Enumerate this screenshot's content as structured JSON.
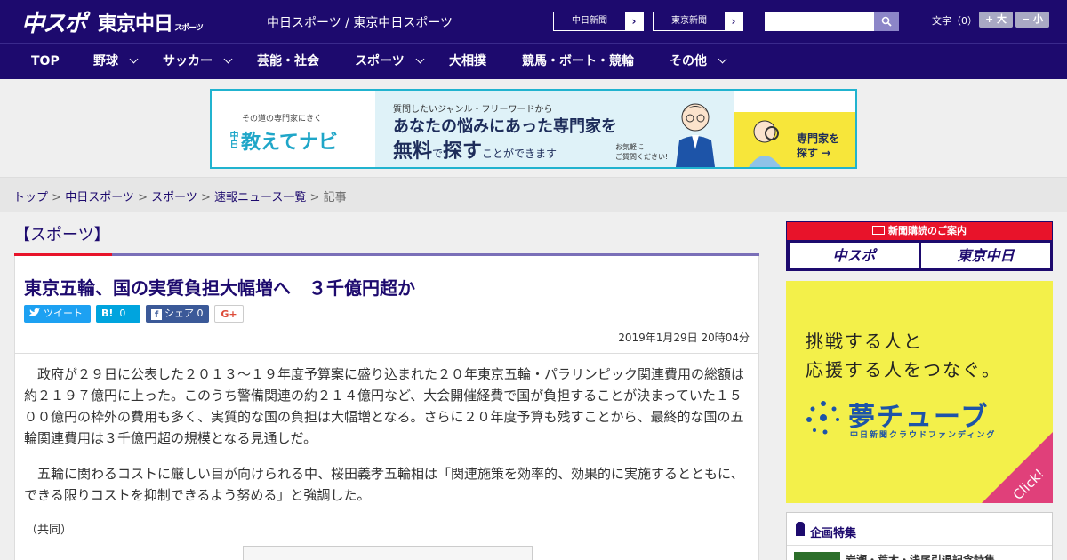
{
  "header": {
    "logo_chuspo": "中スポ",
    "logo_tokyo": "東京中日",
    "logo_tokyo_small": "スポーツ",
    "site_title": "中日スポーツ / 東京中日スポーツ",
    "paper_buttons": [
      "中日新聞",
      "東京新聞"
    ],
    "search_placeholder": "",
    "font_size_label": "文字（0）",
    "font_plus": "+ 大",
    "font_minus": "− 小"
  },
  "nav": {
    "items": [
      {
        "label": "TOP",
        "dropdown": false
      },
      {
        "label": "野球",
        "dropdown": true
      },
      {
        "label": "サッカー",
        "dropdown": true
      },
      {
        "label": "芸能・社会",
        "dropdown": false
      },
      {
        "label": "スポーツ",
        "dropdown": true
      },
      {
        "label": "大相撲",
        "dropdown": false
      },
      {
        "label": "競馬・ボート・競輪",
        "dropdown": false
      },
      {
        "label": "その他",
        "dropdown": true
      }
    ]
  },
  "banner": {
    "left_small": "その道の専門家にきく",
    "left_brand": "教えてナビ",
    "left_brand_prefix": "中日",
    "line1": "質問したいジャンル・フリーワードから",
    "line2": "あなたの悩みにあった専門家を",
    "line3a": "無料",
    "line3b": "で",
    "line3c": "探す",
    "line3d": "ことができます",
    "note": "お気軽に\nご質問ください!",
    "cta": "専門家を\n探す →"
  },
  "breadcrumb": {
    "items": [
      "トップ",
      "中日スポーツ",
      "スポーツ",
      "速報ニュース一覧"
    ],
    "current": "記事",
    "sep": " > "
  },
  "article": {
    "category": "【スポーツ】",
    "title": "東京五輪、国の実質負担大幅増へ　３千億円超か",
    "share": {
      "tweet": "ツイート",
      "hatena": "B!",
      "hatena_count": "0",
      "facebook": "シェア",
      "facebook_count": "0",
      "gplus": "G+"
    },
    "date": "2019年1月29日 20時04分",
    "paragraphs": [
      "政府が２９日に公表した２０１３～１９年度予算案に盛り込まれた２０年東京五輪・パラリンピック関連費用の総額は約２１９７億円に上った。このうち警備関連の約２１４億円など、大会開催経費で国が負担することが決まっていた１５００億円の枠外の費用も多く、実質的な国の負担は大幅増となる。さらに２０年度予算も残すことから、最終的な国の五輪関連費用は３千億円超の規模となる見通しだ。",
      "五輪に関わるコストに厳しい目が向けられる中、桜田義孝五輪相は「関連施策を効率的、効果的に実施するとともに、できる限りコストを抑制できるよう努める」と強調した。"
    ],
    "credit": "（共同）"
  },
  "sidebar": {
    "subscribe_title": "新聞購読のご案内",
    "subscribe_btn1": "中スポ",
    "subscribe_btn2": "東京中日",
    "ad_heading_1": "挑戦する人と",
    "ad_heading_2": "応援する人をつなぐ。",
    "ad_logo": "夢チューブ",
    "ad_sub": "中日新聞クラウドファンディング",
    "ad_click": "Click!",
    "feature_title": "企画特集",
    "feature_item": "岩瀬・荒木・浅尾引退記念特集"
  },
  "colors": {
    "brand_navy": "#1d0a6e",
    "accent_red": "#e8132a",
    "twitter": "#1da1f2",
    "hatena": "#00a4de",
    "facebook": "#3b5998"
  }
}
